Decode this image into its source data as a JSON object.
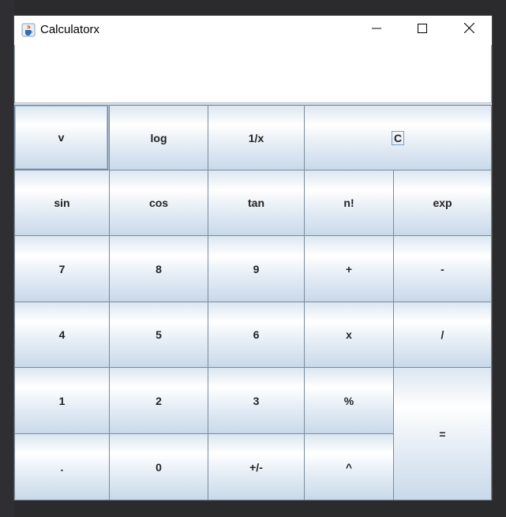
{
  "window": {
    "title": "Calculatorx",
    "icon": "java-cup-icon",
    "controls": {
      "minimize": "minimize-icon",
      "maximize": "maximize-icon",
      "close": "close-icon"
    }
  },
  "display": {
    "value": ""
  },
  "buttons": {
    "sqrt": "v",
    "log": "log",
    "reciprocal": "1/x",
    "clear": "C",
    "sin": "sin",
    "cos": "cos",
    "tan": "tan",
    "factorial": "n!",
    "exp": "exp",
    "d7": "7",
    "d8": "8",
    "d9": "9",
    "plus": "+",
    "minus": "-",
    "d4": "4",
    "d5": "5",
    "d6": "6",
    "times": "x",
    "divide": "/",
    "d1": "1",
    "d2": "2",
    "d3": "3",
    "percent": "%",
    "equals": "=",
    "dot": ".",
    "d0": "0",
    "negate": "+/-",
    "power": "^"
  }
}
